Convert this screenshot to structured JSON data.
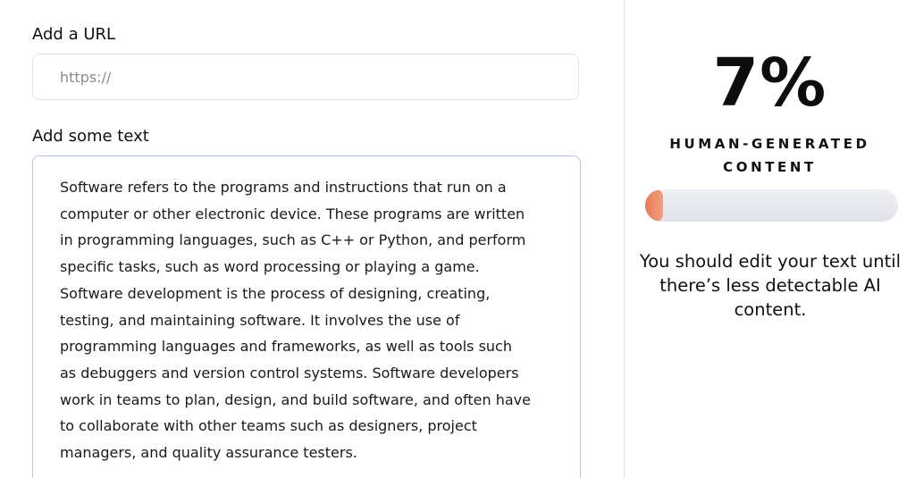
{
  "form": {
    "url_label": "Add a URL",
    "url_placeholder": "https://",
    "url_value": "",
    "text_label": "Add some text",
    "text_value": "Software refers to the programs and instructions that run on a\ncomputer or other electronic device. These programs are written\nin programming languages, such as C++ or Python, and perform\nspecific tasks, such as word processing or playing a game.\nSoftware development is the process of designing, creating,\ntesting, and maintaining software. It involves the use of\nprogramming languages and frameworks, as well as tools such\nas debuggers and version control systems. Software developers\nwork in teams to plan, design, and build software, and often have\nto collaborate with other teams such as designers, project\nmanagers, and quality assurance testers."
  },
  "result": {
    "percent_text": "7%",
    "percent_value": 7,
    "caption_line1": "HUMAN-GENERATED",
    "caption_line2": "CONTENT",
    "advice": "You should edit your text until there’s less detectable AI content."
  },
  "colors": {
    "accent": "#e97a58",
    "textarea_border": "#b9c6f5",
    "track": "#e4e6eb"
  }
}
